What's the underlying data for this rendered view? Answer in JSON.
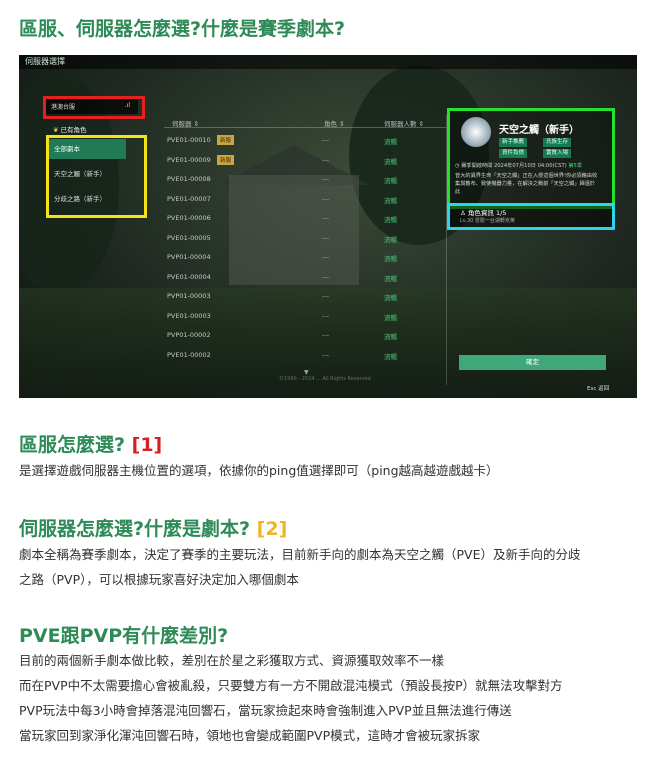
{
  "article": {
    "title": "區服、伺服器怎麼選?什麼是賽季劇本?",
    "sections": [
      {
        "title": "區服怎麼選?",
        "ref": "[1]",
        "ref_color": "#d42020",
        "lines": [
          "是選擇遊戲伺服器主機位置的選項，依據你的ping值選擇即可（ping越高越遊戲越卡）"
        ]
      },
      {
        "title": "伺服器怎麼選?什麼是劇本?",
        "ref": "[2]",
        "ref_color": "#f0b429",
        "lines": [
          "劇本全稱為賽季劇本，決定了賽季的主要玩法，目前新手向的劇本為天空之觸（PVE）及新手向的分歧",
          "之路（PVP），可以根據玩家喜好決定加入哪個劇本"
        ]
      },
      {
        "title": "PVE跟PVP有什麼差別?",
        "ref": "",
        "ref_color": "",
        "lines": [
          "目前的兩個新手劇本做比較，差別在於星之彩獲取方式、資源獲取效率不一樣",
          "而在PVP中不太需要擔心會被亂殺，只要雙方有一方不開啟混沌模式（預設長按P）就無法攻擊對方",
          "PVP玩法中每3小時會掉落混沌回響石，當玩家撿起來時會強制進入PVP並且無法進行傳送",
          "當玩家回到家淨化渾沌回響石時，領地也會變成範圍PVP模式，這時才會被玩家拆家"
        ]
      }
    ]
  },
  "screenshot": {
    "window_title": "伺服器選擇",
    "region_dropdown": {
      "value": "港澳台服",
      "signal": ".ıl"
    },
    "has_role_label": "已有角色",
    "categories": [
      {
        "label": "全部劇本",
        "selected": true
      },
      {
        "label": "天空之觸（新手）",
        "selected": false
      },
      {
        "label": "分歧之路（新手）",
        "selected": false
      }
    ],
    "columns": [
      "伺服器 ⇕",
      "角色 ⇕",
      "伺服器人數 ⇕"
    ],
    "servers": [
      {
        "name": "PVE01-00010",
        "badge": "新服",
        "roles": "---",
        "status": "流暢"
      },
      {
        "name": "PVE01-00009",
        "badge": "新服",
        "roles": "---",
        "status": "流暢"
      },
      {
        "name": "PVE01-00008",
        "badge": "",
        "roles": "---",
        "status": "流暢"
      },
      {
        "name": "PVE01-00007",
        "badge": "",
        "roles": "---",
        "status": "流暢"
      },
      {
        "name": "PVE01-00006",
        "badge": "",
        "roles": "---",
        "status": "流暢"
      },
      {
        "name": "PVE01-00005",
        "badge": "",
        "roles": "---",
        "status": "流暢"
      },
      {
        "name": "PVP01-00004",
        "badge": "",
        "roles": "---",
        "status": "流暢"
      },
      {
        "name": "PVE01-00004",
        "badge": "",
        "roles": "---",
        "status": "流暢"
      },
      {
        "name": "PVP01-00003",
        "badge": "",
        "roles": "---",
        "status": "流暢"
      },
      {
        "name": "PVE01-00003",
        "badge": "",
        "roles": "---",
        "status": "流暢"
      },
      {
        "name": "PVP01-00002",
        "badge": "",
        "roles": "---",
        "status": "流暢"
      },
      {
        "name": "PVE01-00002",
        "badge": "",
        "roles": "---",
        "status": "流暢"
      }
    ],
    "scenario": {
      "title": "天空之觸（新手）",
      "tags": [
        "新手推薦",
        "氏族生存",
        "資件負債",
        "實質入場"
      ],
      "open_time": "賽季開啟時間 2024年07月10日 04:00(CST)",
      "extra": "第5季",
      "description": "曾大的異界生命「天空之觸」正在入侵這個世界!你必須藉由收集與散布、致使機器力量，在解決之戰前「天空之觸」歸還於此"
    },
    "role_info": {
      "label": "角色資訊 1/5",
      "sub": "Lv.30 冒險一台湖轉克萊",
      "caret": "⌄"
    },
    "confirm_label": "確定",
    "esc_label": "Esc 返回",
    "copyright": "©1990 - 2024 ... All Rights Reserved",
    "colors": {
      "annotation_red": "#e62020",
      "annotation_yellow": "#f2e31a",
      "annotation_green": "#27e02d",
      "annotation_cyan": "#2fd4e8",
      "accent": "#2e8b57"
    }
  }
}
